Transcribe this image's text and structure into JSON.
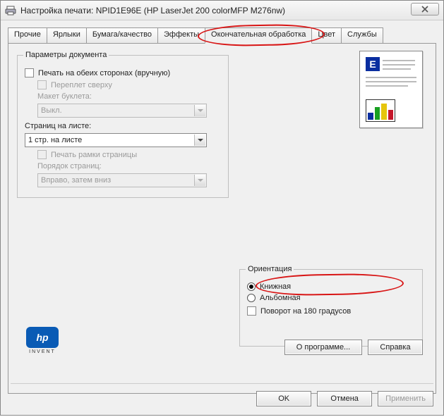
{
  "titlebar": {
    "title": "Настройка печати: NPID1E96E (HP LaserJet 200 colorMFP M276nw)"
  },
  "tabs": {
    "items": [
      {
        "label": "Прочие"
      },
      {
        "label": "Ярлыки"
      },
      {
        "label": "Бумага/качество"
      },
      {
        "label": "Эффекты"
      },
      {
        "label": "Окончательная обработка"
      },
      {
        "label": "Цвет"
      },
      {
        "label": "Службы"
      }
    ],
    "active_index": 4
  },
  "docparams": {
    "legend": "Параметры документа",
    "duplex_label": "Печать на обеих сторонах (вручную)",
    "flip_label": "Переплет сверху",
    "booklet_label": "Макет буклета:",
    "booklet_value": "Выкл.",
    "pages_per_sheet_label": "Страниц на листе:",
    "pages_per_sheet_value": "1 стр. на листе",
    "print_borders_label": "Печать рамки страницы",
    "page_order_label": "Порядок страниц:",
    "page_order_value": "Вправо, затем вниз"
  },
  "orientation": {
    "legend": "Ориентация",
    "portrait": "Книжная",
    "landscape": "Альбомная",
    "rotate": "Поворот на 180 градусов"
  },
  "hp": {
    "invent": "INVENT"
  },
  "buttons": {
    "about": "О программе...",
    "help": "Справка",
    "ok": "OK",
    "cancel": "Отмена",
    "apply": "Применить"
  },
  "preview": {
    "letter": "E"
  }
}
